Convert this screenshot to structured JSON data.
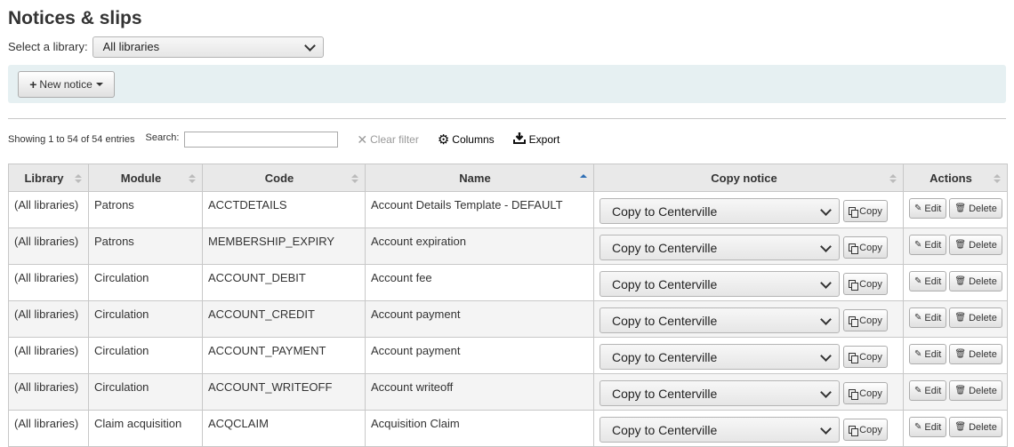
{
  "page": {
    "title": "Notices & slips"
  },
  "library_select": {
    "label": "Select a library:",
    "value": "All libraries"
  },
  "toolbar": {
    "new_notice": "New notice"
  },
  "datatable": {
    "info": "Showing 1 to 54 of 54 entries",
    "search_label": "Search:",
    "search_value": "",
    "clear_filter": "Clear filter",
    "columns": "Columns",
    "export": "Export"
  },
  "table": {
    "headers": {
      "library": "Library",
      "module": "Module",
      "code": "Code",
      "name": "Name",
      "copy_notice": "Copy notice",
      "actions": "Actions"
    },
    "copy_option": "Copy to Centerville",
    "copy_label": "Copy",
    "edit_label": "Edit",
    "delete_label": "Delete",
    "rows": [
      {
        "library": "(All libraries)",
        "module": "Patrons",
        "code": "ACCTDETAILS",
        "name": "Account Details Template - DEFAULT"
      },
      {
        "library": "(All libraries)",
        "module": "Patrons",
        "code": "MEMBERSHIP_EXPIRY",
        "name": "Account expiration"
      },
      {
        "library": "(All libraries)",
        "module": "Circulation",
        "code": "ACCOUNT_DEBIT",
        "name": "Account fee"
      },
      {
        "library": "(All libraries)",
        "module": "Circulation",
        "code": "ACCOUNT_CREDIT",
        "name": "Account payment"
      },
      {
        "library": "(All libraries)",
        "module": "Circulation",
        "code": "ACCOUNT_PAYMENT",
        "name": "Account payment"
      },
      {
        "library": "(All libraries)",
        "module": "Circulation",
        "code": "ACCOUNT_WRITEOFF",
        "name": "Account writeoff"
      },
      {
        "library": "(All libraries)",
        "module": "Claim acquisition",
        "code": "ACQCLAIM",
        "name": "Acquisition Claim"
      }
    ]
  }
}
